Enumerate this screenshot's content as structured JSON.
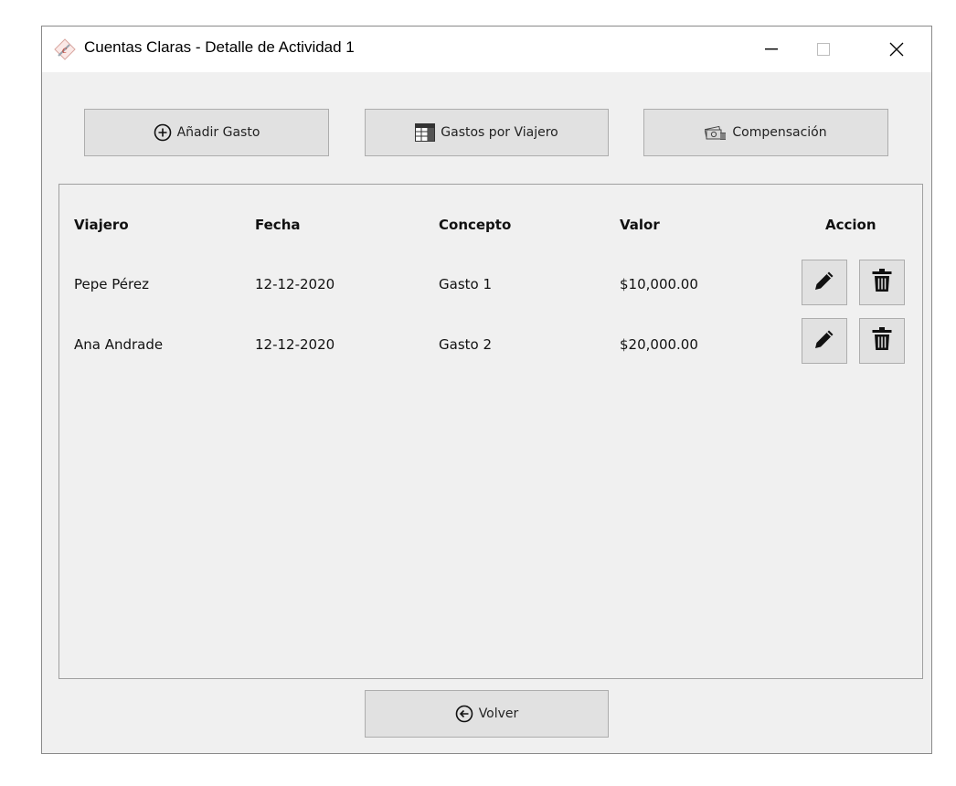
{
  "window": {
    "title": "Cuentas Claras - Detalle de Actividad 1",
    "app_icon": "cuentas-claras-logo"
  },
  "toolbar": {
    "add_expense_label": "Añadir Gasto",
    "expenses_by_traveler_label": "Gastos por Viajero",
    "compensation_label": "Compensación"
  },
  "table": {
    "headers": {
      "viajero": "Viajero",
      "fecha": "Fecha",
      "concepto": "Concepto",
      "valor": "Valor",
      "accion": "Accion"
    },
    "rows": [
      {
        "viajero": "Pepe Pérez",
        "fecha": "12-12-2020",
        "concepto": "Gasto 1",
        "valor": "$10,000.00"
      },
      {
        "viajero": "Ana Andrade",
        "fecha": "12-12-2020",
        "concepto": "Gasto 2",
        "valor": "$20,000.00"
      }
    ],
    "row_actions": [
      "pencil-icon",
      "trash-icon"
    ]
  },
  "footer": {
    "back_label": "Volver"
  },
  "colors": {
    "window_bg": "#f0f0f0",
    "button_bg": "#e1e1e1",
    "button_border": "#adadad",
    "logo_accent": "#c0392b"
  }
}
